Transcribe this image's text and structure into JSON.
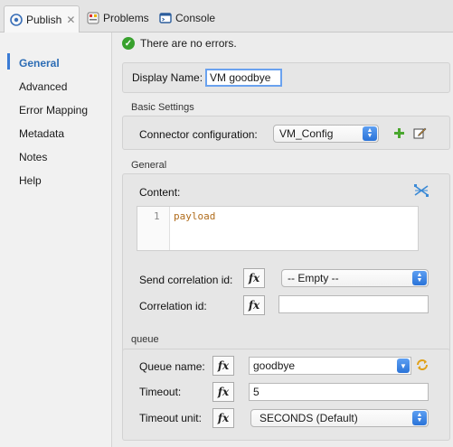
{
  "tabs": [
    {
      "label": "Publish",
      "icon": "connector-icon",
      "active": true
    },
    {
      "label": "Problems",
      "icon": "problems-icon"
    },
    {
      "label": "Console",
      "icon": "console-icon"
    }
  ],
  "nav": {
    "items": [
      {
        "label": "General",
        "active": true
      },
      {
        "label": "Advanced"
      },
      {
        "label": "Error Mapping"
      },
      {
        "label": "Metadata"
      },
      {
        "label": "Notes"
      },
      {
        "label": "Help"
      }
    ]
  },
  "status": {
    "text": "There are no errors.",
    "color": "#38a12d"
  },
  "display": {
    "label": "Display Name:",
    "value": "VM goodbye"
  },
  "basic": {
    "title": "Basic Settings",
    "connector_label": "Connector configuration:",
    "connector_value": "VM_Config"
  },
  "general": {
    "title": "General",
    "content_label": "Content:",
    "line_number": "1",
    "code": "payload",
    "send_corr_label": "Send correlation id:",
    "send_corr_value": "-- Empty --",
    "corr_label": "Correlation id:",
    "corr_value": ""
  },
  "queue": {
    "title": "queue",
    "name_label": "Queue name:",
    "name_value": "goodbye",
    "timeout_label": "Timeout:",
    "timeout_value": "5",
    "unit_label": "Timeout unit:",
    "unit_value": "SECONDS (Default)"
  },
  "fx_label": "fx",
  "colors": {
    "accent": "#3a7bd5",
    "select_caret": "#2a73d8"
  }
}
